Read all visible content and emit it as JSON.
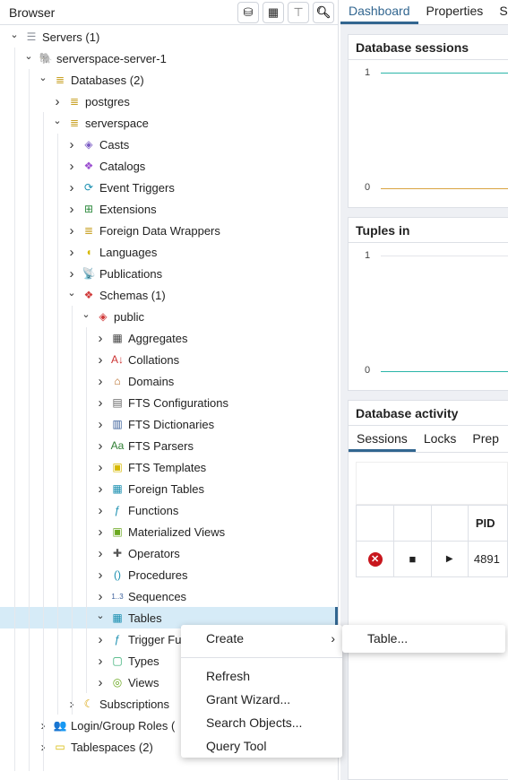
{
  "browser": {
    "title": "Browser",
    "toolbar": [
      "query-tool-icon",
      "view-data-icon",
      "filtered-rows-icon",
      "search-icon"
    ]
  },
  "tree": [
    {
      "label": "Servers (1)",
      "level": 0,
      "open": true,
      "icon": "servers-icon",
      "color": "#8a8f99",
      "glyph": "☰"
    },
    {
      "label": "serverspace-server-1",
      "level": 1,
      "open": true,
      "icon": "postgres-elephant-icon",
      "color": "#336791",
      "glyph": "🐘"
    },
    {
      "label": "Databases (2)",
      "level": 2,
      "open": true,
      "icon": "databases-icon",
      "color": "#c9a227",
      "glyph": "≣"
    },
    {
      "label": "postgres",
      "level": 3,
      "open": false,
      "icon": "database-icon",
      "color": "#c9a227",
      "glyph": "≣"
    },
    {
      "label": "serverspace",
      "level": 3,
      "open": true,
      "icon": "database-icon",
      "color": "#c9a227",
      "glyph": "≣"
    },
    {
      "label": "Casts",
      "level": 4,
      "open": false,
      "icon": "casts-icon",
      "color": "#7b5cc4",
      "glyph": "◈"
    },
    {
      "label": "Catalogs",
      "level": 4,
      "open": false,
      "icon": "catalogs-icon",
      "color": "#9b4fd0",
      "glyph": "❖"
    },
    {
      "label": "Event Triggers",
      "level": 4,
      "open": false,
      "icon": "event-triggers-icon",
      "color": "#1a8fb0",
      "glyph": "⟳"
    },
    {
      "label": "Extensions",
      "level": 4,
      "open": false,
      "icon": "extensions-icon",
      "color": "#2e8b3e",
      "glyph": "⊞"
    },
    {
      "label": "Foreign Data Wrappers",
      "level": 4,
      "open": false,
      "icon": "fdw-icon",
      "color": "#c9a227",
      "glyph": "≣"
    },
    {
      "label": "Languages",
      "level": 4,
      "open": false,
      "icon": "languages-icon",
      "color": "#d6b800",
      "glyph": "◖"
    },
    {
      "label": "Publications",
      "level": 4,
      "open": false,
      "icon": "publications-icon",
      "color": "#3a5f9a",
      "glyph": "📡"
    },
    {
      "label": "Schemas (1)",
      "level": 4,
      "open": true,
      "icon": "schemas-icon",
      "color": "#d03a3a",
      "glyph": "❖"
    },
    {
      "label": "public",
      "level": 5,
      "open": true,
      "icon": "schema-icon",
      "color": "#d03a3a",
      "glyph": "◈"
    },
    {
      "label": "Aggregates",
      "level": 6,
      "open": false,
      "icon": "aggregates-icon",
      "color": "#444",
      "glyph": "▦"
    },
    {
      "label": "Collations",
      "level": 6,
      "open": false,
      "icon": "collations-icon",
      "color": "#c33",
      "glyph": "A↓"
    },
    {
      "label": "Domains",
      "level": 6,
      "open": false,
      "icon": "domains-icon",
      "color": "#b5651d",
      "glyph": "⌂"
    },
    {
      "label": "FTS Configurations",
      "level": 6,
      "open": false,
      "icon": "fts-config-icon",
      "color": "#666",
      "glyph": "▤"
    },
    {
      "label": "FTS Dictionaries",
      "level": 6,
      "open": false,
      "icon": "fts-dict-icon",
      "color": "#3a5f9a",
      "glyph": "▥"
    },
    {
      "label": "FTS Parsers",
      "level": 6,
      "open": false,
      "icon": "fts-parsers-icon",
      "color": "#2e7d32",
      "glyph": "Aa"
    },
    {
      "label": "FTS Templates",
      "level": 6,
      "open": false,
      "icon": "fts-templates-icon",
      "color": "#d6b800",
      "glyph": "▣"
    },
    {
      "label": "Foreign Tables",
      "level": 6,
      "open": false,
      "icon": "foreign-tables-icon",
      "color": "#1a8fb0",
      "glyph": "▦"
    },
    {
      "label": "Functions",
      "level": 6,
      "open": false,
      "icon": "functions-icon",
      "color": "#1a8fb0",
      "glyph": "ƒ"
    },
    {
      "label": "Materialized Views",
      "level": 6,
      "open": false,
      "icon": "mat-views-icon",
      "color": "#6aa820",
      "glyph": "▣"
    },
    {
      "label": "Operators",
      "level": 6,
      "open": false,
      "icon": "operators-icon",
      "color": "#555",
      "glyph": "✚"
    },
    {
      "label": "Procedures",
      "level": 6,
      "open": false,
      "icon": "procedures-icon",
      "color": "#1a8fb0",
      "glyph": "()"
    },
    {
      "label": "Sequences",
      "level": 6,
      "open": false,
      "icon": "sequences-icon",
      "color": "#3a5f9a",
      "glyph": "1..3"
    },
    {
      "label": "Tables",
      "level": 6,
      "open": true,
      "icon": "tables-icon",
      "color": "#1a8fb0",
      "glyph": "▦",
      "selected": true
    },
    {
      "label": "Trigger Fu",
      "level": 6,
      "open": false,
      "icon": "trigger-functions-icon",
      "color": "#1a8fb0",
      "glyph": "ƒ"
    },
    {
      "label": "Types",
      "level": 6,
      "open": false,
      "icon": "types-icon",
      "color": "#2eaa6e",
      "glyph": "▢"
    },
    {
      "label": "Views",
      "level": 6,
      "open": false,
      "icon": "views-icon",
      "color": "#6aa820",
      "glyph": "◎"
    },
    {
      "label": "Subscriptions",
      "level": 4,
      "open": false,
      "icon": "subscriptions-icon",
      "color": "#d6a000",
      "glyph": "☾"
    },
    {
      "label": "Login/Group Roles (",
      "level": 2,
      "open": false,
      "icon": "roles-icon",
      "color": "#c33",
      "glyph": "👥"
    },
    {
      "label": "Tablespaces (2)",
      "level": 2,
      "open": false,
      "icon": "tablespaces-icon",
      "color": "#d6b800",
      "glyph": "▭"
    }
  ],
  "tabs": {
    "dashboard": "Dashboard",
    "properties": "Properties",
    "sql": "S"
  },
  "sessions": {
    "title": "Database sessions",
    "y_top": "1",
    "y_bottom": "0"
  },
  "tuples": {
    "title": "Tuples in",
    "y_top": "1",
    "y_bottom": "0"
  },
  "activity": {
    "title": "Database activity",
    "tabs": [
      "Sessions",
      "Locks",
      "Prep"
    ],
    "col_pid": "PID",
    "pid": "4891"
  },
  "context_menu": {
    "create": "Create",
    "refresh": "Refresh",
    "grant": "Grant Wizard...",
    "search": "Search Objects...",
    "query": "Query Tool"
  },
  "submenu": {
    "table": "Table..."
  },
  "colors": {
    "accent": "#326690",
    "selected_bg": "#d6ebf7",
    "series_teal": "#2bb5a8",
    "series_orange": "#d9a441"
  }
}
